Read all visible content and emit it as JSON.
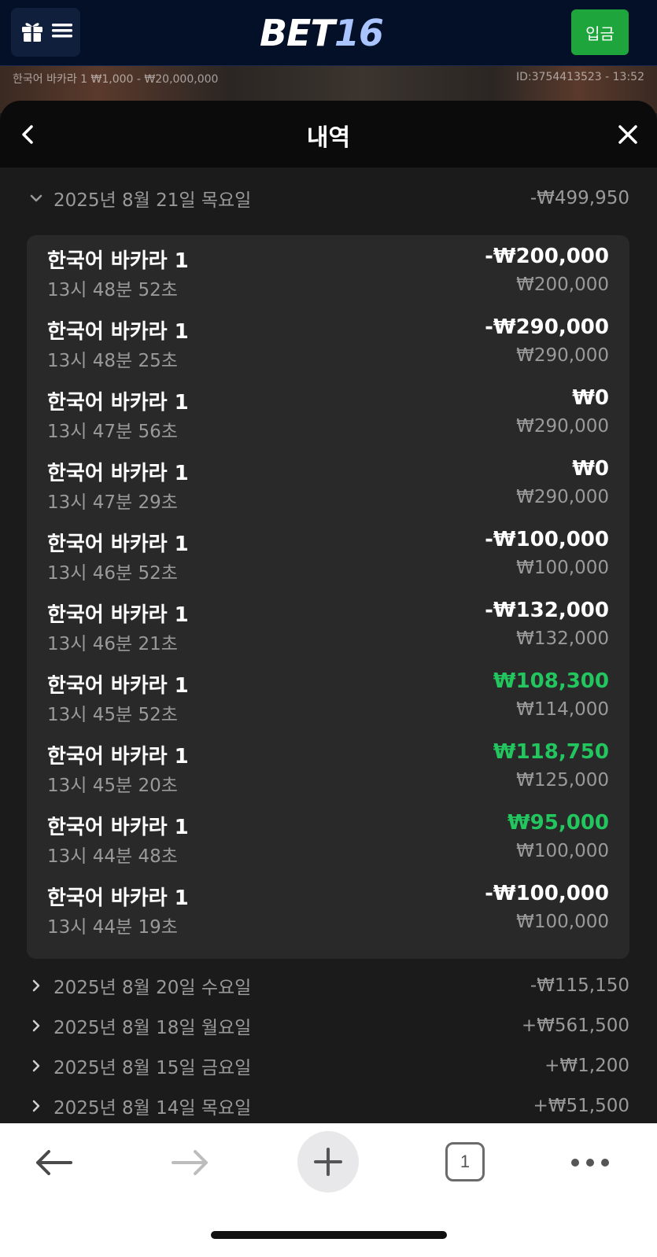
{
  "header": {
    "logo_part1": "BET",
    "logo_part2": "16",
    "deposit_label": "입금"
  },
  "game_strip": {
    "left_text": "한국어 바카라 1  ₩1,000 - ₩20,000,000",
    "right_text": "ID:3754413523 - 13:52"
  },
  "sheet": {
    "title": "내역"
  },
  "expanded_day": {
    "date": "2025년 8월 21일 목요일",
    "total": "-₩499,950",
    "items": [
      {
        "game": "한국어 바카라 1",
        "time": "13시 48분 52초",
        "amount": "-₩200,000",
        "bet": "₩200,000",
        "win": false
      },
      {
        "game": "한국어 바카라 1",
        "time": "13시 48분 25초",
        "amount": "-₩290,000",
        "bet": "₩290,000",
        "win": false
      },
      {
        "game": "한국어 바카라 1",
        "time": "13시 47분 56초",
        "amount": "₩0",
        "bet": "₩290,000",
        "win": false
      },
      {
        "game": "한국어 바카라 1",
        "time": "13시 47분 29초",
        "amount": "₩0",
        "bet": "₩290,000",
        "win": false
      },
      {
        "game": "한국어 바카라 1",
        "time": "13시 46분 52초",
        "amount": "-₩100,000",
        "bet": "₩100,000",
        "win": false
      },
      {
        "game": "한국어 바카라 1",
        "time": "13시 46분 21초",
        "amount": "-₩132,000",
        "bet": "₩132,000",
        "win": false
      },
      {
        "game": "한국어 바카라 1",
        "time": "13시 45분 52초",
        "amount": "₩108,300",
        "bet": "₩114,000",
        "win": true
      },
      {
        "game": "한국어 바카라 1",
        "time": "13시 45분 20초",
        "amount": "₩118,750",
        "bet": "₩125,000",
        "win": true
      },
      {
        "game": "한국어 바카라 1",
        "time": "13시 44분 48초",
        "amount": "₩95,000",
        "bet": "₩100,000",
        "win": true
      },
      {
        "game": "한국어 바카라 1",
        "time": "13시 44분 19초",
        "amount": "-₩100,000",
        "bet": "₩100,000",
        "win": false
      }
    ]
  },
  "collapsed_days": [
    {
      "date": "2025년 8월 20일 수요일",
      "total": "-₩115,150"
    },
    {
      "date": "2025년 8월 18일 월요일",
      "total": "+₩561,500"
    },
    {
      "date": "2025년 8월 15일 금요일",
      "total": "+₩1,200"
    },
    {
      "date": "2025년 8월 14일 목요일",
      "total": "+₩51,500"
    }
  ],
  "browser": {
    "tab_count": "1"
  },
  "colors": {
    "win": "#22c55e",
    "deposit": "#1ea53b",
    "topbar": "#031027"
  }
}
